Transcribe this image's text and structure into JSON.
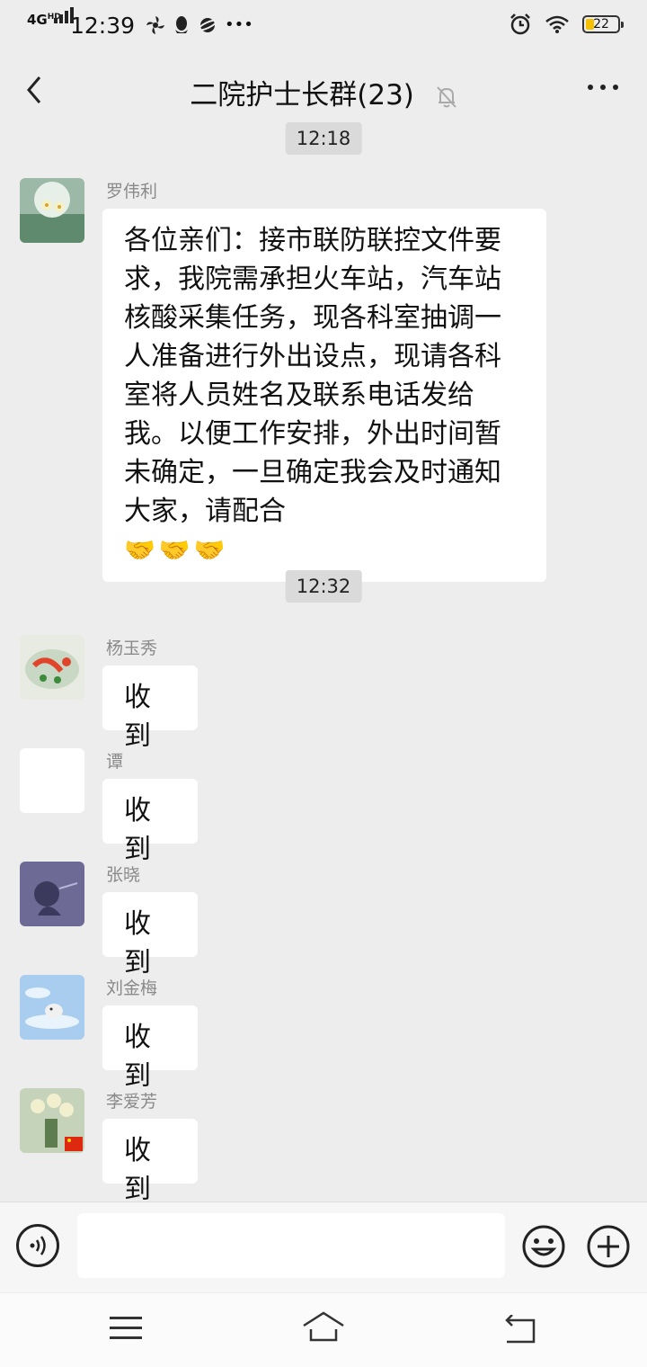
{
  "status_bar": {
    "network": "4G",
    "network_sup": "HD",
    "time": "12:39",
    "icons": [
      "fan-icon",
      "qq-icon",
      "planet-icon",
      "more-dots"
    ],
    "battery": "22"
  },
  "header": {
    "title": "二院护士长群(23)",
    "mute_icon": "bell-off-icon"
  },
  "chat": {
    "timestamps": [
      "12:18",
      "12:32"
    ],
    "messages": [
      {
        "sender": "罗伟利",
        "text": "各位亲们：接市联防联控文件要求，我院需承担火车站，汽车站核酸采集任务，现各科室抽调一人准备进行外出设点，现请各科室将人员姓名及联系电话发给我。以便工作安排，外出时间暂未确定，一旦确定我会及时通知大家，请配合",
        "emoji": "🤝🤝🤝"
      },
      {
        "sender": "杨玉秀",
        "text": "收到"
      },
      {
        "sender": "谭",
        "text": "收到"
      },
      {
        "sender": "张晓",
        "text": "收到"
      },
      {
        "sender": "刘金梅",
        "text": "收到"
      },
      {
        "sender": "李爱芳",
        "text": "收到"
      }
    ]
  },
  "input": {
    "value": "",
    "voice_icon": "voice-icon",
    "emoji_icon": "emoji-icon",
    "plus_icon": "plus-icon"
  },
  "nav": {
    "icons": [
      "menu-icon",
      "home-icon",
      "back-icon"
    ]
  },
  "colors": {
    "background": "#ededed",
    "bubble": "#ffffff",
    "battery_fill": "#f5c000"
  }
}
